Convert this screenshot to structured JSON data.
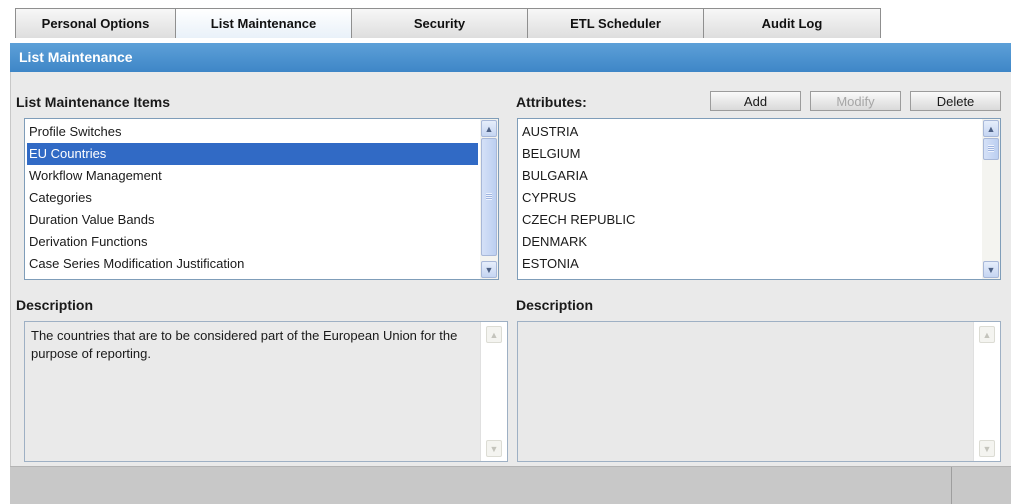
{
  "tabs": [
    {
      "label": "Personal Options",
      "active": false
    },
    {
      "label": "List Maintenance",
      "active": true
    },
    {
      "label": "Security",
      "active": false
    },
    {
      "label": "ETL Scheduler",
      "active": false
    },
    {
      "label": "Audit Log",
      "active": false
    }
  ],
  "title": "List Maintenance",
  "list_section": {
    "heading": "List Maintenance Items",
    "items": [
      "Profile Switches",
      "EU Countries",
      "Workflow Management",
      "Categories",
      "Duration Value Bands",
      "Derivation Functions",
      "Case Series Modification Justification"
    ],
    "selected": "EU Countries"
  },
  "attributes_section": {
    "heading": "Attributes:",
    "items": [
      "AUSTRIA",
      "BELGIUM",
      "BULGARIA",
      "CYPRUS",
      "CZECH REPUBLIC",
      "DENMARK",
      "ESTONIA"
    ]
  },
  "buttons": {
    "add": "Add",
    "modify": "Modify",
    "delete": "Delete"
  },
  "description_left": {
    "heading": "Description",
    "text": "The countries that are to be considered part of the European Union for the purpose of reporting."
  },
  "description_right": {
    "heading": "Description",
    "text": ""
  },
  "colors": {
    "title_bar": "#4a90d0",
    "selection": "#316ac5",
    "panel_bg": "#eaeaea",
    "footer_bg": "#c8c8c8"
  },
  "icons": {
    "scroll_up": "chevron-up-icon",
    "scroll_down": "chevron-down-icon"
  }
}
